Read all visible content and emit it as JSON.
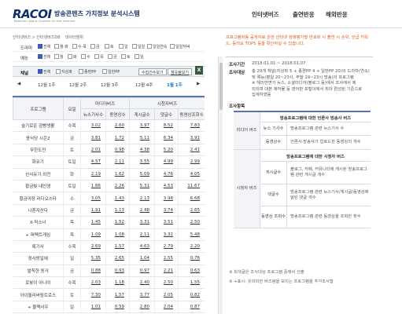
{
  "header": {
    "logo": "RACOI",
    "logo_sub": "Reaction About Content On the Internet",
    "site_title": "방송콘텐츠 가치정보 분석시스템",
    "nav": [
      "인터넷버즈",
      "출연반응",
      "해외반응"
    ]
  },
  "breadcrumb": [
    "인터넷버즈 > 인터넷버즈D8",
    "데이터범위"
  ],
  "filters": {
    "drama": {
      "label": "드라마",
      "options": [
        "전체",
        "월·화",
        "수·목",
        "금",
        "토",
        "일",
        "일일",
        "일일연속",
        "일일저녁"
      ]
    },
    "entertainment": {
      "label": "예능",
      "options": [
        "전체",
        "월",
        "화",
        "수",
        "목",
        "금",
        "토",
        "일"
      ]
    }
  },
  "channel": {
    "label": "채널",
    "options": [
      "전체",
      "지상파",
      "종편PP",
      "일반PP"
    ],
    "button_primary": "수집건수보기",
    "button_secondary": "점유율보기",
    "excel_icon": "excel-icon"
  },
  "weeks": [
    "12월 1주",
    "12월 2주",
    "12월 3주",
    "12월 4주",
    "1월 1주"
  ],
  "table": {
    "group_headers": [
      "미디어버즈",
      "시청자버즈"
    ],
    "headers": [
      "프로그램",
      "요일",
      "뉴스기사수",
      "동영상수",
      "게시글수",
      "댓글수",
      "동영상조회수"
    ],
    "rows": [
      [
        "슬기로운 감빵생활",
        "수목",
        "3.02",
        "2.60",
        "3.97",
        "8.52",
        "7.83"
      ],
      [
        "윤식당 시즌2",
        "금",
        "3.81",
        "1.72",
        "5.11",
        "6.34",
        "3.91"
      ],
      [
        "무한도전",
        "토",
        "2.01",
        "0.98",
        "4.38",
        "5.20",
        "2.41"
      ],
      [
        "화유기",
        "토일",
        "4.57",
        "2.11",
        "3.55",
        "4.99",
        "2.99"
      ],
      [
        "신서유기 외전",
        "화",
        "2.19",
        "1.62",
        "5.09",
        "4.76",
        "4.05"
      ],
      [
        "황금빛 내인생",
        "토일",
        "1.86",
        "2.26",
        "5.31",
        "4.53",
        "11.67"
      ],
      [
        "황금어장 라디오스타",
        "수",
        "3.05",
        "1.43",
        "2.13",
        "3.98",
        "6.68"
      ],
      [
        "나혼자산다",
        "금",
        "1.91",
        "1.13",
        "2.48",
        "3.74",
        "2.65"
      ],
      [
        "X-믹스너",
        "목",
        "1.45",
        "1.52",
        "3.31",
        "3.51",
        "2.50"
      ],
      [
        "+ 퍼펙트게임",
        "목",
        "1.09",
        "1.08",
        "2.11",
        "3.32",
        "5.48"
      ],
      [
        "록기사",
        "수목",
        "2.69",
        "1.57",
        "4.63",
        "2.79",
        "2.20"
      ],
      [
        "정사랑일에",
        "일",
        "5.35",
        "2.65",
        "1.04",
        "2.55",
        "0.76"
      ],
      [
        "발칙한 동거",
        "금",
        "0.88",
        "0.93",
        "0.97",
        "2.21",
        "0.63"
      ],
      [
        "로봇이 아니야",
        "수목",
        "2.03",
        "1.18",
        "2.40",
        "2.50",
        "1.55"
      ],
      [
        "아이돌리버링트로스",
        "토",
        "7.30",
        "1.57",
        "3.77",
        "2.05",
        "0.82"
      ],
      [
        "+ 블랙사우",
        "일",
        "1.01",
        "0.59",
        "2.80",
        "2.04",
        "0.87"
      ]
    ]
  },
  "notice": "프로그램화용 공개자료 관한 인터넷 장례평가형 번호화 시 출연 시 순위, 언급 키워드, 등려요 TOP5 등을 확인하실 수 있습니다.",
  "period": {
    "label": "조사기간",
    "value": "2018.01.01 ~ 2018.01.07"
  },
  "target": {
    "label": "조사대상",
    "lines": [
      "총 29개 채널(지상파 5 + 종편PP 4 + 일반PP 20)의 드라마(연속)",
      "및 예능(평일 20~23시, 주말 19~23시 방송)의 프로그램",
      "※ 해외반면가 뉴스, 소셜미디어(블로그 등)에서 조사에서 제",
      "외되며 대본 제작물 등 영어판 포털이에서 최대 편성된 기준으로",
      "집계하였음"
    ]
  },
  "criteria": {
    "title": "조사항목",
    "media_label": "미디어 버즈",
    "media_head": "방송프로그램에 대한 언론사 방송사 버즈",
    "media_rows": [
      [
        "뉴스 기사수",
        "방송프로그램 관련 뉴스기사 수"
      ],
      [
        "동영상수",
        "언론사·방송사가 업로드한 동영상의 개수"
      ]
    ],
    "viewer_label": "시청자 버즈",
    "viewer_head": "방송프로그램에 대한 시청자 버즈",
    "viewer_rows": [
      [
        "게시글수",
        "블로그, 카페, 커뮤니티에 게시된 방송프로그램 관련 게시글 개수"
      ],
      [
        "댓글수",
        "방송프로그램 관련 뉴스기사/게시글/동영상에 달린 댓글 개수"
      ],
      [
        "동영상 조회수",
        "방송프로그램 관련 동영상을 조회한 횟수"
      ]
    ]
  },
  "footnotes": [
    "※ 회색글은 조사대상 프로그램 중에서 선출",
    "※ +표시: 유의미한 버즈량을 보이는 프로그램을 추가조사함"
  ]
}
